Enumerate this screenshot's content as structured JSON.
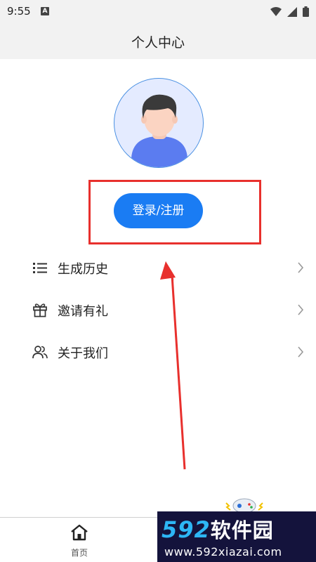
{
  "status_bar": {
    "time": "9:55",
    "notification_badge": "A",
    "icons": [
      "wifi-icon",
      "signal-icon",
      "battery-icon"
    ]
  },
  "header": {
    "title": "个人中心"
  },
  "profile": {
    "avatar": "avatar-placeholder",
    "login_label": "登录/注册"
  },
  "menu": {
    "items": [
      {
        "icon": "list-icon",
        "label": "生成历史"
      },
      {
        "icon": "gift-icon",
        "label": "邀请有礼"
      },
      {
        "icon": "users-icon",
        "label": "关于我们"
      }
    ]
  },
  "tab_bar": {
    "home_label": "首页"
  },
  "watermark": {
    "number": "592",
    "brand": "软件园",
    "url": "www.592xiazai.com"
  },
  "colors": {
    "accent": "#1a7cf3",
    "highlight": "#e8302d",
    "avatar_bg": "#e4ebff",
    "watermark_bg": "#14133c"
  }
}
